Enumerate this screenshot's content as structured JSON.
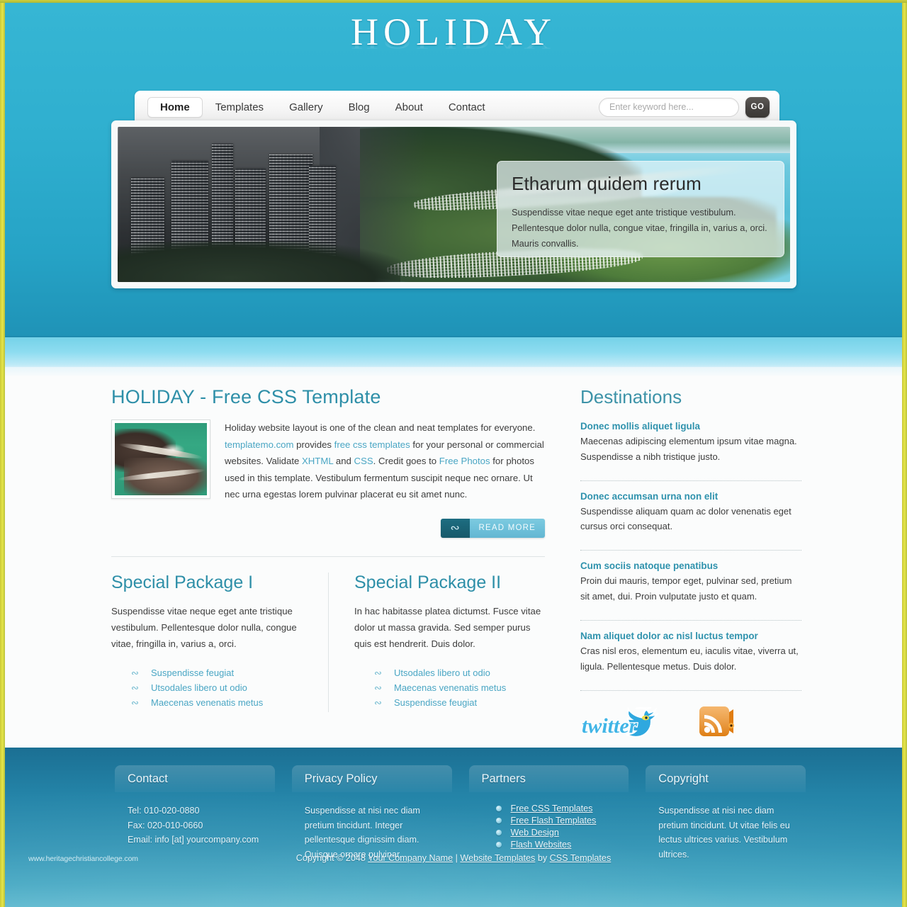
{
  "site": {
    "logo": "HOLIDAY"
  },
  "nav": {
    "items": [
      {
        "label": "Home",
        "active": true
      },
      {
        "label": "Templates",
        "active": false
      },
      {
        "label": "Gallery",
        "active": false
      },
      {
        "label": "Blog",
        "active": false
      },
      {
        "label": "About",
        "active": false
      },
      {
        "label": "Contact",
        "active": false
      }
    ]
  },
  "search": {
    "placeholder": "Enter keyword here...",
    "value": "",
    "button_label": "GO"
  },
  "banner": {
    "heading": "Etharum quidem rerum",
    "paragraph": "Suspendisse vitae neque eget ante tristique vestibulum. Pellentesque dolor nulla, congue vitae, fringilla in, varius a, orci. Mauris convallis.",
    "image_alt": "aerial-view-of-city-lakefront-and-marina"
  },
  "main": {
    "title": "HOLIDAY - Free CSS Template",
    "thumb_alt": "aerial-view-of-green-lagoon-and-roads",
    "intro": {
      "part1": "Holiday website layout is one of the clean and neat templates for everyone. ",
      "link1": "templatemo.com",
      "part2": " provides ",
      "link2": "free css templates",
      "part3": " for your personal or commercial websites. Validate ",
      "link3": "XHTML",
      "part4": " and ",
      "link4": "CSS",
      "part5": ". Credit goes to ",
      "link5": "Free Photos",
      "part6": " for photos used in this template. Vestibulum fermentum suscipit neque nec ornare. Ut nec urna egestas lorem pulvinar placerat eu sit amet nunc."
    },
    "read_more": "READ MORE",
    "packages": [
      {
        "title": "Special Package I",
        "text": "Suspendisse vitae neque eget ante tristique vestibulum. Pellentesque dolor nulla, congue vitae, fringilla in, varius a, orci.",
        "links": [
          "Suspendisse feugiat",
          "Utsodales libero ut odio",
          "Maecenas venenatis metus"
        ]
      },
      {
        "title": "Special Package II",
        "text": "In hac habitasse platea dictumst. Fusce vitae dolor ut massa gravida. Sed semper purus quis est hendrerit. Duis dolor.",
        "links": [
          "Utsodales libero ut odio",
          "Maecenas venenatis metus",
          "Suspendisse feugiat"
        ]
      }
    ]
  },
  "sidebar": {
    "title": "Destinations",
    "items": [
      {
        "title": "Donec mollis aliquet ligula",
        "text": "Maecenas adipiscing elementum ipsum vitae magna. Suspendisse a nibh tristique justo."
      },
      {
        "title": "Donec accumsan urna non elit",
        "text": "Suspendisse aliquam quam ac dolor venenatis eget cursus orci consequat."
      },
      {
        "title": "Cum sociis natoque penatibus",
        "text": "Proin dui mauris, tempor eget, pulvinar sed, pretium sit amet, dui. Proin vulputate justo et quam."
      },
      {
        "title": "Nam aliquet dolor ac nisl luctus tempor",
        "text": "Cras nisl eros, elementum eu, iaculis vitae, viverra ut, ligula. Pellentesque metus. Duis dolor."
      }
    ],
    "social": {
      "twitter_label": "twitter",
      "rss_label": "RSS Feed"
    }
  },
  "footer": {
    "columns": [
      {
        "title": "Contact",
        "type": "lines",
        "lines": [
          "Tel: 010-020-0880",
          "Fax: 020-010-0660",
          "Email: info [at] yourcompany.com"
        ]
      },
      {
        "title": "Privacy Policy",
        "type": "text",
        "text": "Suspendisse at nisi nec diam pretium tincidunt. Integer pellentesque dignissim diam. Quisque ornare pulvinar."
      },
      {
        "title": "Partners",
        "type": "links",
        "links": [
          "Free CSS Templates",
          "Free Flash Templates",
          "Web Design",
          "Flash Websites"
        ]
      },
      {
        "title": "Copyright",
        "type": "text",
        "text": "Suspendisse at nisi nec diam pretium tincidunt. Ut vitae felis eu lectus ultrices varius. Vestibulum ultrices."
      }
    ],
    "watermark": "www.heritagechristiancollege.com",
    "copyright": {
      "prefix": "Copyright © 2048 ",
      "company": "Your Company Name",
      "separator": " | ",
      "link_templates": "Website Templates",
      "by": " by ",
      "link_css": "CSS Templates"
    }
  },
  "colors": {
    "brand_teal": "#2aa8c9",
    "heading_teal": "#2e8fa8",
    "link_blue": "#4aa6c4",
    "footer_blue": "#2484a8",
    "border_yellow": "#cfcf3e"
  }
}
